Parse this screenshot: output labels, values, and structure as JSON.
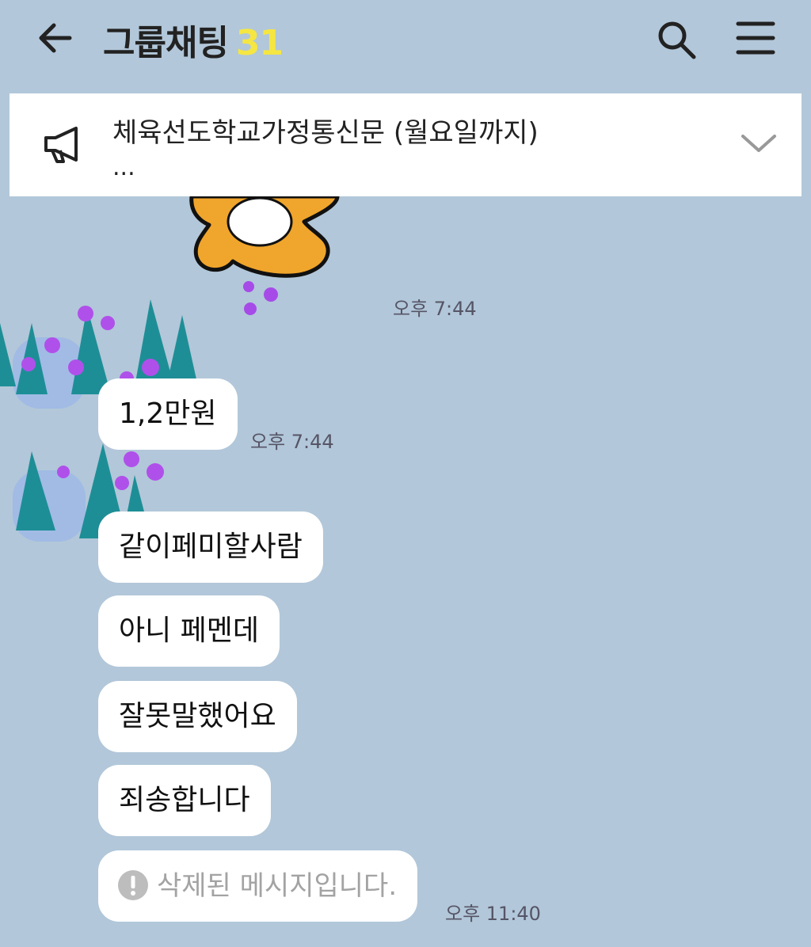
{
  "header": {
    "title": "그룹채팅",
    "member_count": "31",
    "icons": {
      "back": "back-arrow-icon",
      "search": "search-icon",
      "menu": "menu-icon"
    }
  },
  "notice": {
    "text": "체육선도학교가정통신문 (월요일까지)",
    "more": "...",
    "icons": {
      "lead": "megaphone-icon",
      "expand": "chevron-down-icon"
    }
  },
  "messages": {
    "sticker_time": "오후 7:44",
    "msg1": {
      "text": "1,2만원",
      "time": "오후 7:44"
    },
    "msg2": {
      "text": "같이페미할사람"
    },
    "msg3": {
      "text": "아니 페멘데"
    },
    "msg4": {
      "text": "잘못말했어요"
    },
    "msg5": {
      "text": "죄송합니다"
    },
    "msg6": {
      "text": "삭제된 메시지입니다.",
      "time": "오후 11:40"
    }
  },
  "colors": {
    "background": "#b2c7d9",
    "member_count": "#f5e642",
    "bubble": "#ffffff",
    "deleted_text": "#a3a3a3"
  }
}
